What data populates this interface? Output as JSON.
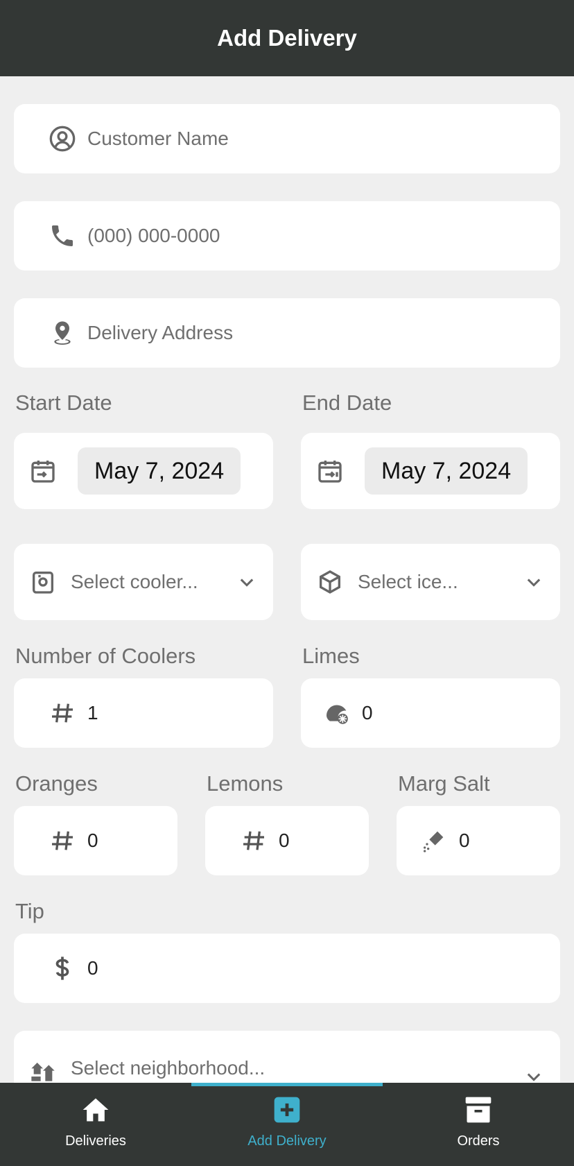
{
  "header": {
    "title": "Add Delivery"
  },
  "form": {
    "customer_name": {
      "placeholder": "Customer Name",
      "icon": "user-circle-icon"
    },
    "phone": {
      "placeholder": "(000) 000-0000",
      "icon": "phone-icon"
    },
    "address": {
      "placeholder": "Delivery Address",
      "icon": "location-pin-icon"
    },
    "start_date": {
      "label": "Start Date",
      "value": "May 7, 2024",
      "icon": "calendar-start-icon"
    },
    "end_date": {
      "label": "End Date",
      "value": "May 7, 2024",
      "icon": "calendar-end-icon"
    },
    "cooler_select": {
      "placeholder": "Select cooler...",
      "icon": "cooler-icon"
    },
    "ice_select": {
      "placeholder": "Select ice...",
      "icon": "cube-icon"
    },
    "num_coolers": {
      "label": "Number of Coolers",
      "value": "1",
      "icon": "hash-icon"
    },
    "limes": {
      "label": "Limes",
      "value": "0",
      "icon": "lime-icon"
    },
    "oranges": {
      "label": "Oranges",
      "value": "0",
      "icon": "hash-icon"
    },
    "lemons": {
      "label": "Lemons",
      "value": "0",
      "icon": "hash-icon"
    },
    "marg_salt": {
      "label": "Marg Salt",
      "value": "0",
      "icon": "salt-shaker-icon"
    },
    "tip": {
      "label": "Tip",
      "value": "0",
      "icon": "dollar-icon"
    },
    "neighborhood_select": {
      "placeholder": "Select neighborhood...",
      "icon": "houses-icon"
    }
  },
  "tabs": [
    {
      "label": "Deliveries",
      "icon": "home-icon",
      "active": false
    },
    {
      "label": "Add Delivery",
      "icon": "plus-square-icon",
      "active": true
    },
    {
      "label": "Orders",
      "icon": "archive-icon",
      "active": false
    }
  ],
  "colors": {
    "header_bg": "#333735",
    "accent": "#3fb0cc",
    "background": "#efefef"
  }
}
